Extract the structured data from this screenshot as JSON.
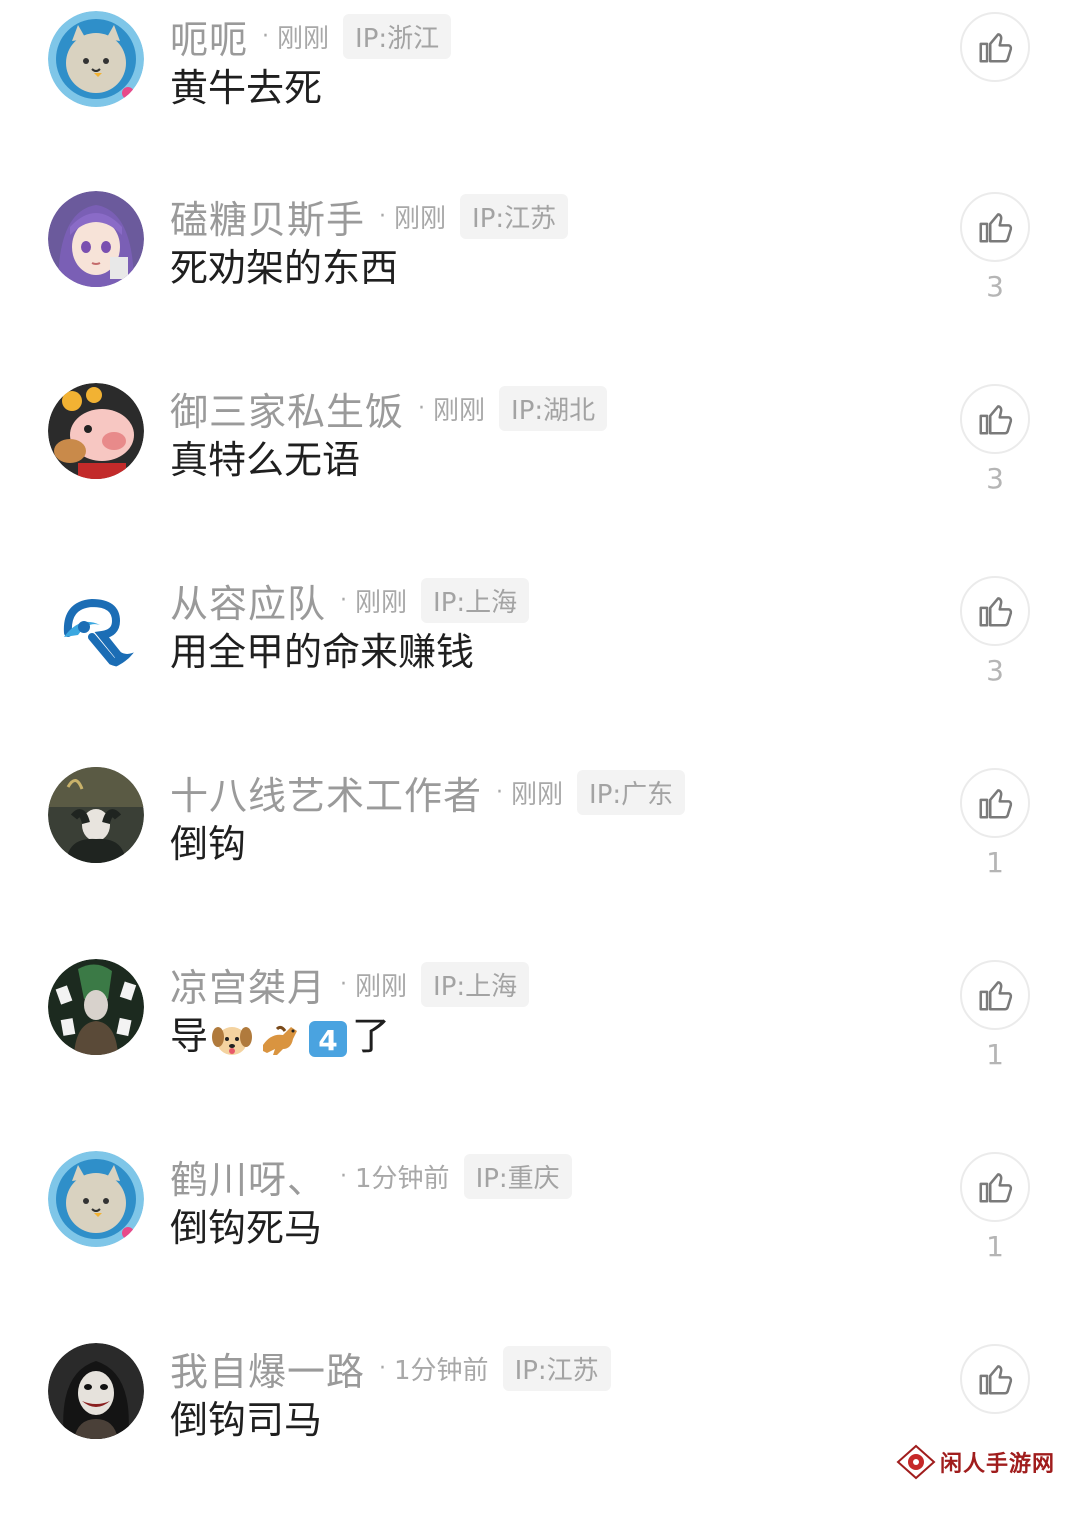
{
  "comments": [
    {
      "username": "呃呃",
      "time": "刚刚",
      "ip": "IP:浙江",
      "content": "黄牛去死",
      "likes": ""
    },
    {
      "username": "磕糖贝斯手",
      "time": "刚刚",
      "ip": "IP:江苏",
      "content": "死劝架的东西",
      "likes": "3"
    },
    {
      "username": "御三家私生饭",
      "time": "刚刚",
      "ip": "IP:湖北",
      "content": "真特么无语",
      "likes": "3"
    },
    {
      "username": "从容应队",
      "time": "刚刚",
      "ip": "IP:上海",
      "content": "用全甲的命来赚钱",
      "likes": "3"
    },
    {
      "username": "十八线艺术工作者",
      "time": "刚刚",
      "ip": "IP:广东",
      "content": "倒钩",
      "likes": "1"
    },
    {
      "username": "凉宫桀月",
      "time": "刚刚",
      "ip": "IP:上海",
      "content": "导🐶🐎4️⃣了",
      "content_parts": [
        "导",
        "了"
      ],
      "content_emojis": [
        "dog-face-emoji",
        "horse-emoji",
        "keycap-4-emoji"
      ],
      "likes": "1"
    },
    {
      "username": "鹤川呀、",
      "time": "1分钟前",
      "ip": "IP:重庆",
      "content": "倒钩死马",
      "likes": "1"
    },
    {
      "username": "我自爆一路",
      "time": "1分钟前",
      "ip": "IP:江苏",
      "content": "倒钩司马",
      "likes": ""
    }
  ],
  "separator": "·",
  "watermark": {
    "text": "闲人手游网",
    "color": "#a01d1d"
  },
  "icons": {
    "like": "thumbs-up-icon"
  },
  "colors": {
    "username": "#9a9a9a",
    "content": "#1f1f1f",
    "ip_tag_bg": "#f3f3f3",
    "like_border": "#ebebeb"
  }
}
